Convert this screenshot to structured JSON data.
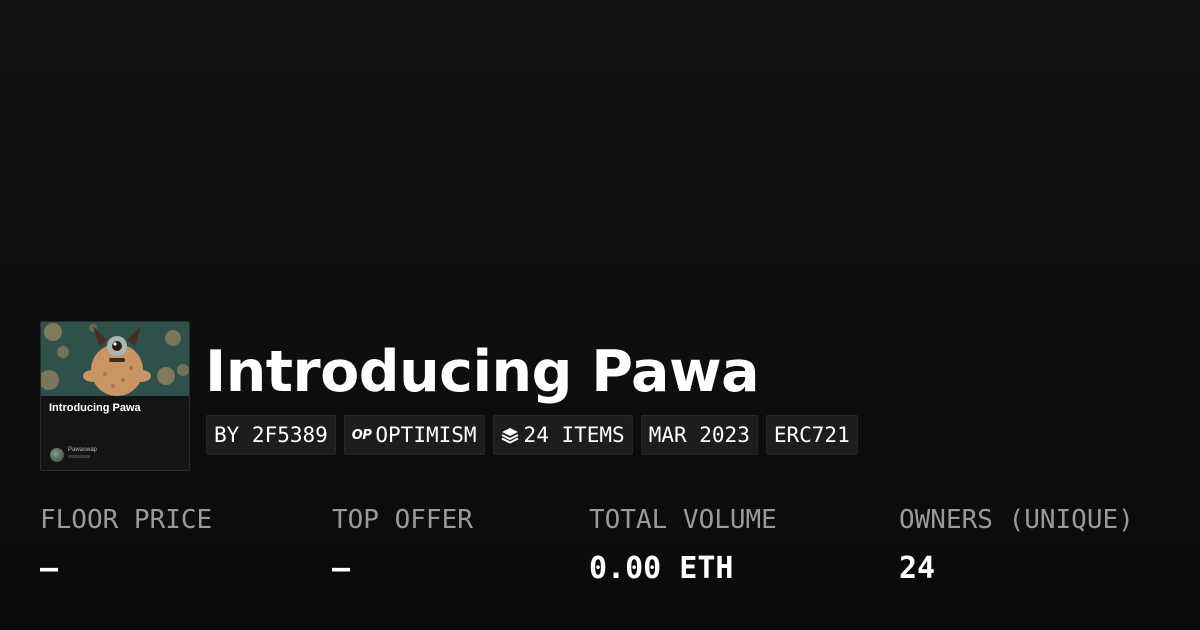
{
  "collection": {
    "title": "Introducing Pawa",
    "card": {
      "title": "Introducing Pawa",
      "owner_name": "Pawaswap"
    },
    "tags": {
      "creator": "BY 2F5389",
      "chain_icon": "OP",
      "chain": "OPTIMISM",
      "items": "24 ITEMS",
      "date": "MAR 2023",
      "standard": "ERC721"
    }
  },
  "stats": [
    {
      "label": "FLOOR PRICE",
      "value": "–"
    },
    {
      "label": "TOP OFFER",
      "value": "–"
    },
    {
      "label": "TOTAL VOLUME",
      "value": "0.00 ETH"
    },
    {
      "label": "OWNERS (UNIQUE)",
      "value": "24"
    }
  ],
  "icons": {
    "chain": "optimism-logo-icon",
    "items": "layers-icon"
  },
  "colors": {
    "background": "#0b0b0b",
    "tag_bg": "#1d1d1d",
    "label": "#9a9a9a",
    "text": "#ffffff"
  }
}
